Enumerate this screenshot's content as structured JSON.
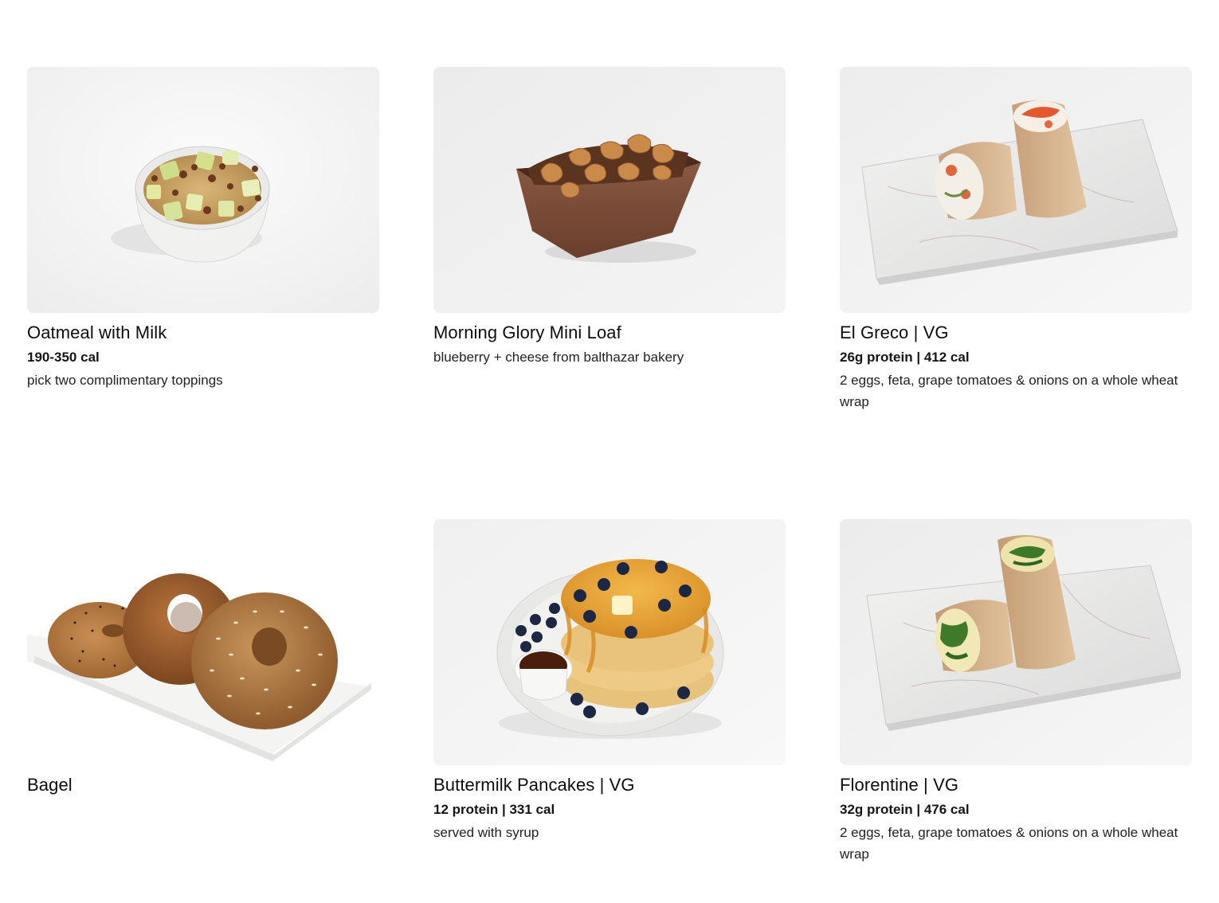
{
  "menu_items": [
    {
      "title": "Oatmeal with Milk",
      "meta": "190-350 cal",
      "description": "pick two complimentary toppings",
      "image_icon": "oatmeal-bowl-photo"
    },
    {
      "title": "Morning Glory Mini Loaf",
      "meta": "",
      "description": "blueberry + cheese from balthazar bakery",
      "image_icon": "mini-loaf-photo"
    },
    {
      "title": "El Greco | VG",
      "meta": "26g protein | 412 cal",
      "description": "2 eggs, feta, grape tomatoes & onions on a whole wheat wrap",
      "image_icon": "wrap-on-marble-photo"
    },
    {
      "title": "Bagel",
      "meta": "",
      "description": "",
      "image_icon": "bagels-on-plate-photo"
    },
    {
      "title": "Buttermilk Pancakes | VG",
      "meta": "12 protein | 331 cal",
      "description": "served with syrup",
      "image_icon": "pancakes-plate-photo"
    },
    {
      "title": "Florentine | VG",
      "meta": "32g protein | 476 cal",
      "description": "2 eggs, feta, grape tomatoes & onions on a whole wheat wrap",
      "image_icon": "spinach-wrap-photo"
    }
  ]
}
